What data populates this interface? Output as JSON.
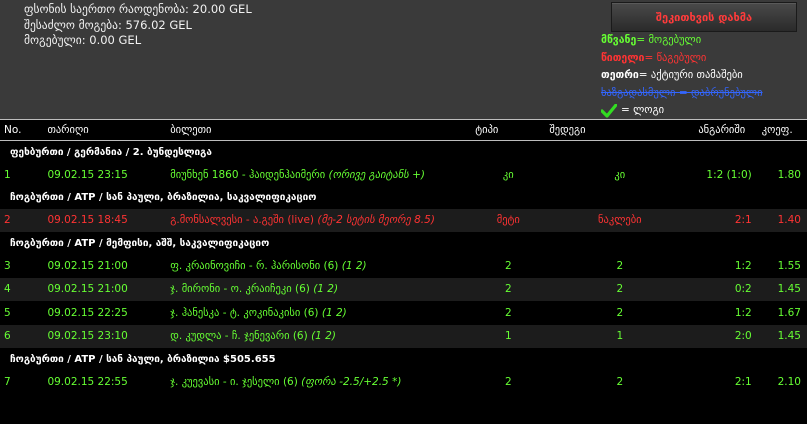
{
  "summary": {
    "total_stake": "ფსონის საერთო რაოდენობა: 20.00 GEL",
    "possible_win": "შესაძლო მოგება: 576.02 GEL",
    "won": "მოგებული: 0.00 GEL"
  },
  "close_button_label": "შეკითხვის დახმა",
  "legend": {
    "won_key": "მწვანე",
    "won_text": " = მოგებული",
    "lost_key": "წითელი",
    "lost_text": " = წაგებული",
    "active_key": "თეთრი",
    "active_text": " = აქტიური თამაშები",
    "returned_text": "ხაზგადასმული = დაბრუნებული",
    "single_text": " = ლოგი"
  },
  "colors": {
    "won": "#66ff33",
    "lost": "#ff3333",
    "active": "#ffffff",
    "returned": "#3366ff",
    "panel": "#3a3a3a"
  },
  "columns": {
    "no": "No.",
    "date": "თარიღი",
    "event": "ბილეთი",
    "type": "ტიპი",
    "result": "შედეგი",
    "score": "ანგარიში",
    "odds": "კოეფ."
  },
  "rows": [
    {
      "kind": "group",
      "label": "ფეხბურთი / გერმანია / 2. ბუნდესლიგა"
    },
    {
      "kind": "bet",
      "no": "1",
      "date": "09.02.15 23:15",
      "event": "მიუნხენ 1860 - ჰაიდენჰაიმერი ",
      "note": "(ორივე გაიტანს +)",
      "type": "კი",
      "result": "კი",
      "score": "1:2 (1:0)",
      "odds": "1.80",
      "status": "won"
    },
    {
      "kind": "group",
      "label": "ჩოგბურთი / ATP / სან პაული, ბრაზილია, საკვალიფიკაციო"
    },
    {
      "kind": "bet",
      "no": "2",
      "date": "09.02.15 18:45",
      "event": "გ.მონსალვესი - ა.გეში (live) ",
      "note": "(მე-2 სეტის მეორე 8.5)",
      "type": "მეტი",
      "result": "ნაკლები",
      "score": "2:1",
      "odds": "1.40",
      "status": "lost"
    },
    {
      "kind": "group",
      "label": "ჩოგბურთი / ATP / მემფისი, აშშ, საკვალიფიკაციო"
    },
    {
      "kind": "bet",
      "no": "3",
      "date": "09.02.15 21:00",
      "event": "ფ. კრაინოვიჩი - რ. ჰარისონი (6) ",
      "note": "(1 2)",
      "type": "2",
      "result": "2",
      "score": "1:2",
      "odds": "1.55",
      "status": "won"
    },
    {
      "kind": "bet",
      "no": "4",
      "date": "09.02.15 21:00",
      "event": "ჯ. მირონი - ო. კრაიჩეკი (6) ",
      "note": "(1 2)",
      "type": "2",
      "result": "2",
      "score": "0:2",
      "odds": "1.45",
      "status": "won"
    },
    {
      "kind": "bet",
      "no": "5",
      "date": "09.02.15 22:25",
      "event": "ჯ. ჰანესკა - ტ. კოკინაკისი (6) ",
      "note": "(1 2)",
      "type": "2",
      "result": "2",
      "score": "1:2",
      "odds": "1.67",
      "status": "won"
    },
    {
      "kind": "bet",
      "no": "6",
      "date": "09.02.15 23:10",
      "event": "დ. კუდლა - ჩ. ჯენევარი (6) ",
      "note": "(1 2)",
      "type": "1",
      "result": "1",
      "score": "2:0",
      "odds": "1.45",
      "status": "won"
    },
    {
      "kind": "group",
      "label": "ჩოგბურთი / ATP / სან პაული, ბრაზილია $505.655"
    },
    {
      "kind": "bet",
      "no": "7",
      "date": "09.02.15 22:55",
      "event": "ჯ. კუევასი - ი. ჯესელი (6) ",
      "note": "(ფორა -2.5/+2.5 *)",
      "type": "2",
      "result": "2",
      "score": "2:1",
      "odds": "2.10",
      "status": "won"
    }
  ]
}
